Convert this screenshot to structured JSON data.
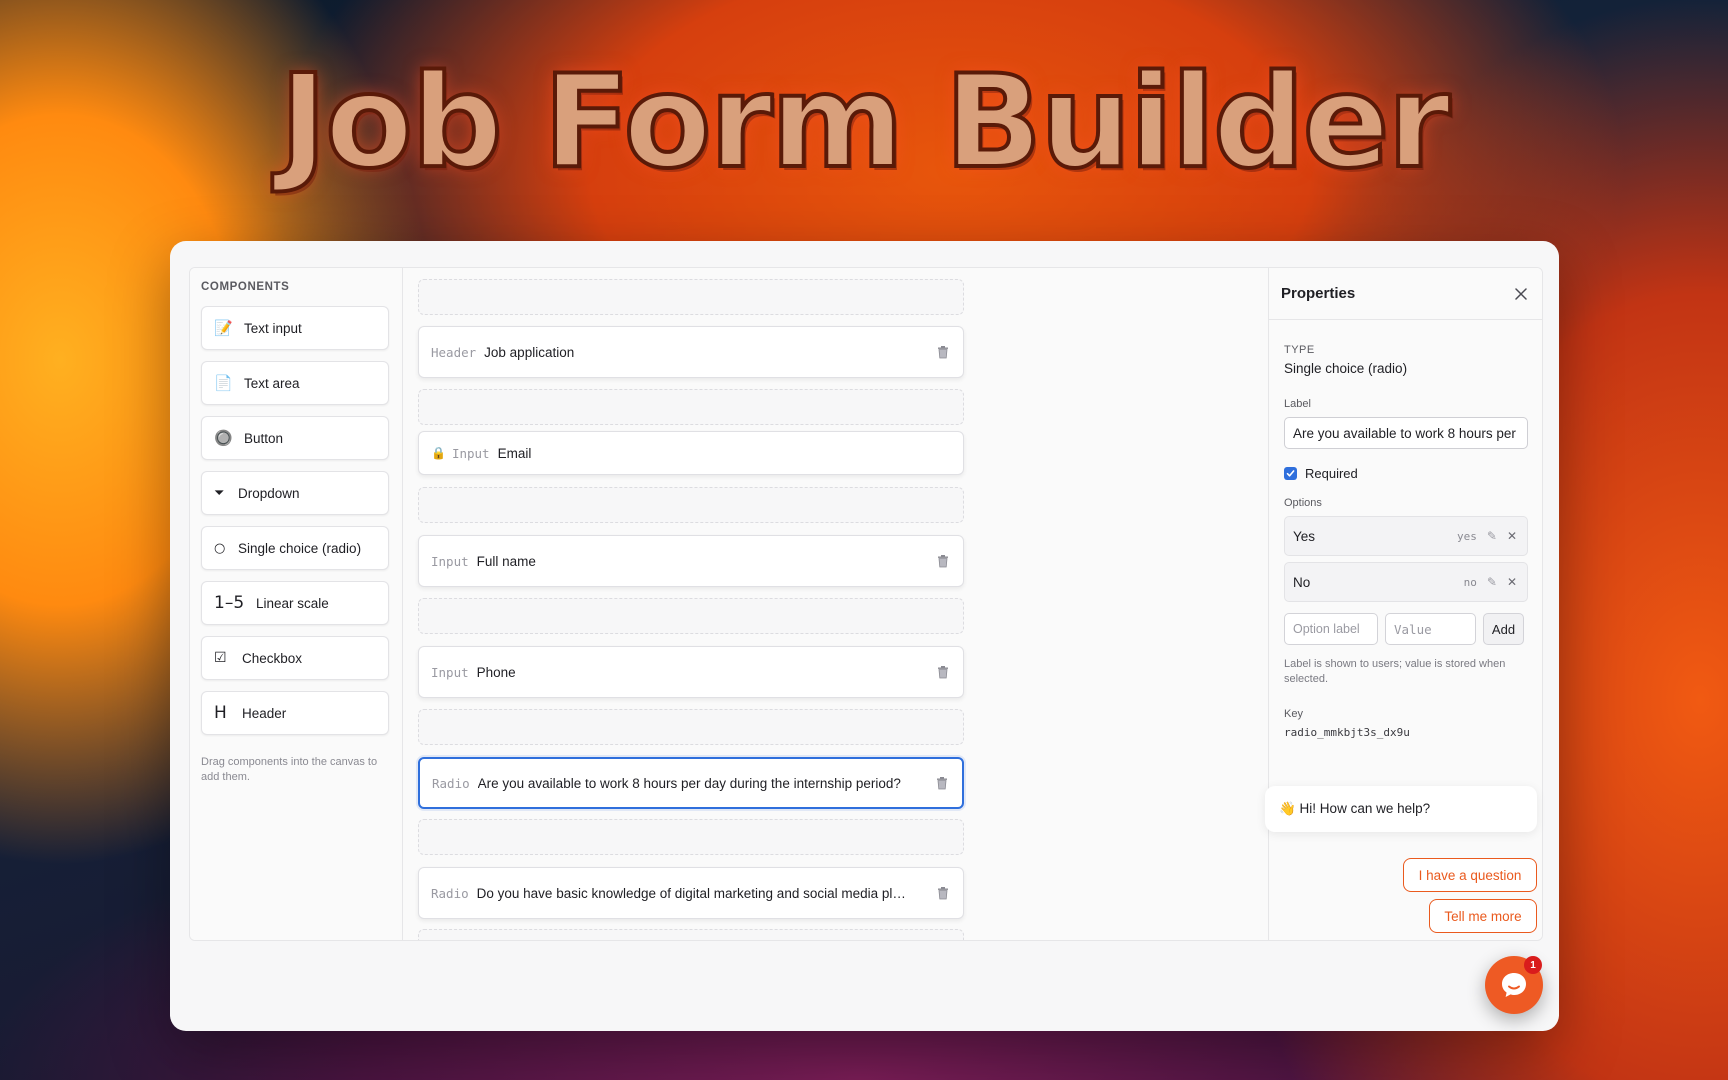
{
  "hero": {
    "title": "Job Form Builder"
  },
  "sidebar": {
    "heading": "COMPONENTS",
    "items": [
      {
        "label": "Text input",
        "icon": "📝"
      },
      {
        "label": "Text area",
        "icon": "📄"
      },
      {
        "label": "Button",
        "icon": "🔘"
      },
      {
        "label": "Dropdown",
        "icon": "⏷"
      },
      {
        "label": "Single choice (radio)",
        "icon": "○"
      },
      {
        "label": "Linear scale",
        "icon": "1–5"
      },
      {
        "label": "Checkbox",
        "icon": "☑"
      },
      {
        "label": "Header",
        "icon": "H"
      }
    ],
    "hint": "Drag components into the canvas to add them."
  },
  "canvas": {
    "cards": [
      {
        "type": "Header",
        "label": "Job application"
      },
      {
        "type": "Input",
        "label": "Email"
      },
      {
        "type": "Input",
        "label": "Full name"
      },
      {
        "type": "Input",
        "label": "Phone"
      },
      {
        "type": "Radio",
        "label": "Are you available to work 8 hours per day during the internship period?"
      },
      {
        "type": "Radio",
        "label": "Do you have basic knowledge of digital marketing and social media pl…"
      }
    ]
  },
  "properties": {
    "title": "Properties",
    "type_label": "TYPE",
    "type_value": "Single choice (radio)",
    "label_label": "Label",
    "label_value": "Are you available to work 8 hours per",
    "required_label": "Required",
    "options_label": "Options",
    "options": [
      {
        "label": "Yes",
        "value": "yes"
      },
      {
        "label": "No",
        "value": "no"
      }
    ],
    "option_label_placeholder": "Option label",
    "value_placeholder": "Value",
    "add_label": "Add",
    "hint": "Label is shown to users; value is stored when selected.",
    "key_label": "Key",
    "key_value": "radio_mmkbjt3s_dx9u"
  },
  "chat": {
    "greeting": "👋 Hi! How can we help?",
    "quick_1": "I have a question",
    "quick_2": "Tell me more",
    "badge": "1"
  },
  "colors": {
    "accent": "#2f6fdc",
    "chat": "#ee5a24"
  }
}
